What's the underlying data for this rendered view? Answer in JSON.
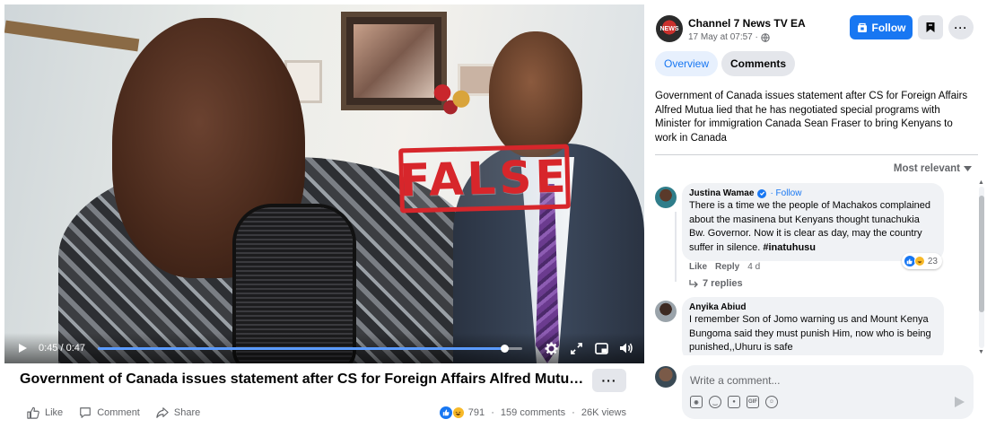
{
  "video": {
    "stamp_text": "FALSE",
    "current_time": "0:45",
    "duration": "0:47",
    "progress": 0.957
  },
  "post": {
    "title": "Government of Canada issues statement after CS for Foreign Affairs Alfred Mutua lied that he has negotiated special programs with Minister for immigration Canada Sean Fraser to bring Kenyans to work in Canada",
    "more_label": "···",
    "actions": {
      "like": "Like",
      "comment": "Comment",
      "share": "Share"
    },
    "reactions_count": "791",
    "comments_count": "159 comments",
    "views": "26K views"
  },
  "channel": {
    "name": "Channel 7 News TV EA",
    "date": "17 May at 07:57 ·",
    "avatar_text": "NEWS",
    "follow_label": "Follow",
    "more_label": "···"
  },
  "tabs": {
    "overview": "Overview",
    "comments": "Comments"
  },
  "description": "Government of Canada issues statement after CS for Foreign Affairs Alfred Mutua lied that he has negotiated special programs with Minister for immigration Canada Sean Fraser to bring Kenyans to work in Canada",
  "sort_label": "Most relevant",
  "comments": [
    {
      "author": "Justina Wamae",
      "follow": "· Follow",
      "text": "There is a time we the people of Machakos complained about the masinena but Kenyans thought tunachukia Bw. Governor. Now it is clear as day, may the country suffer in silence. ",
      "hashtag": "#inatuhusu",
      "reactions": "23",
      "like": "Like",
      "reply": "Reply",
      "age": "4 d",
      "replies": "7 replies"
    },
    {
      "author": "Anyika Abiud",
      "text": "I remember Son of Jomo warning us and Mount Kenya Bungoma said they must punish Him, now who is being punished,,Uhuru is safe"
    }
  ],
  "composer": {
    "placeholder": "Write a comment..."
  },
  "colors": {
    "accent": "#1877f2",
    "stamp": "#d7262b",
    "bubble": "#f0f2f5"
  }
}
